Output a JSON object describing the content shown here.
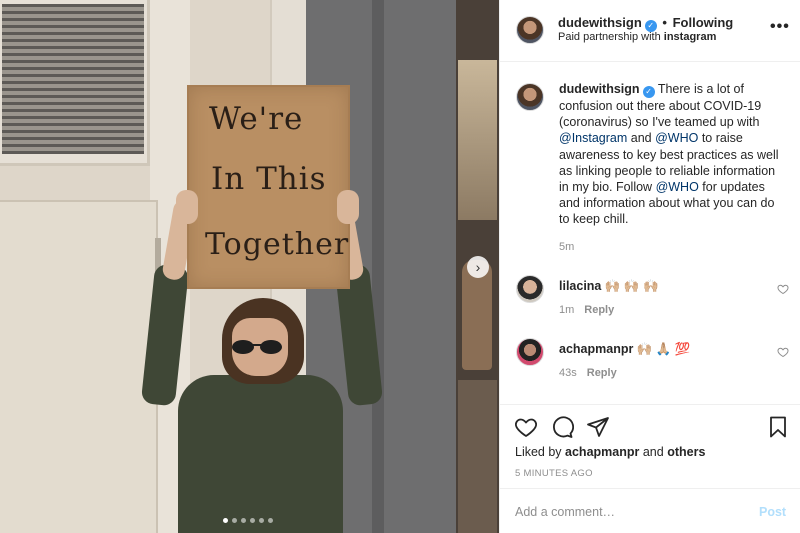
{
  "photo": {
    "sign_lines": [
      "We're",
      "In This",
      "Together"
    ],
    "carousel_dot_count": 6,
    "carousel_active_index": 0,
    "next_icon": "chevron-right-icon"
  },
  "header": {
    "username": "dudewithsign",
    "separator": "•",
    "follow_label": "Following",
    "subtitle_prefix": "Paid partnership with ",
    "subtitle_partner": "instagram",
    "more_icon": "more-options-icon"
  },
  "caption": {
    "username": "dudewithsign",
    "text_1": "There is a lot of confusion out there about COVID-19 (coronavirus) so I've teamed up with ",
    "mention_1": "@Instagram",
    "text_2": " and ",
    "mention_2": "@WHO",
    "text_3": " to raise awareness to key best practices as well as linking people to reliable information in my bio. Follow ",
    "mention_3": "@WHO",
    "text_4": " for updates and information about what you can do to keep chill.",
    "time": "5m"
  },
  "comments": [
    {
      "username": "lilacina",
      "text": "🙌🏼 🙌🏼 🙌🏼",
      "time": "1m",
      "reply_label": "Reply"
    },
    {
      "username": "achapmanpr",
      "text": "🙌🏼 🙏🏼 💯",
      "time": "43s",
      "reply_label": "Reply"
    }
  ],
  "actions": {
    "liked_prefix": "Liked by ",
    "liked_user": "achapmanpr",
    "liked_mid": " and ",
    "liked_others": "others",
    "age": "5 MINUTES AGO"
  },
  "add_comment": {
    "placeholder": "Add a comment…",
    "post_label": "Post"
  },
  "colors": {
    "verified": "#3897f0",
    "mention": "#003569",
    "post_disabled": "#b2dffc",
    "muted": "#8e8e8e"
  }
}
